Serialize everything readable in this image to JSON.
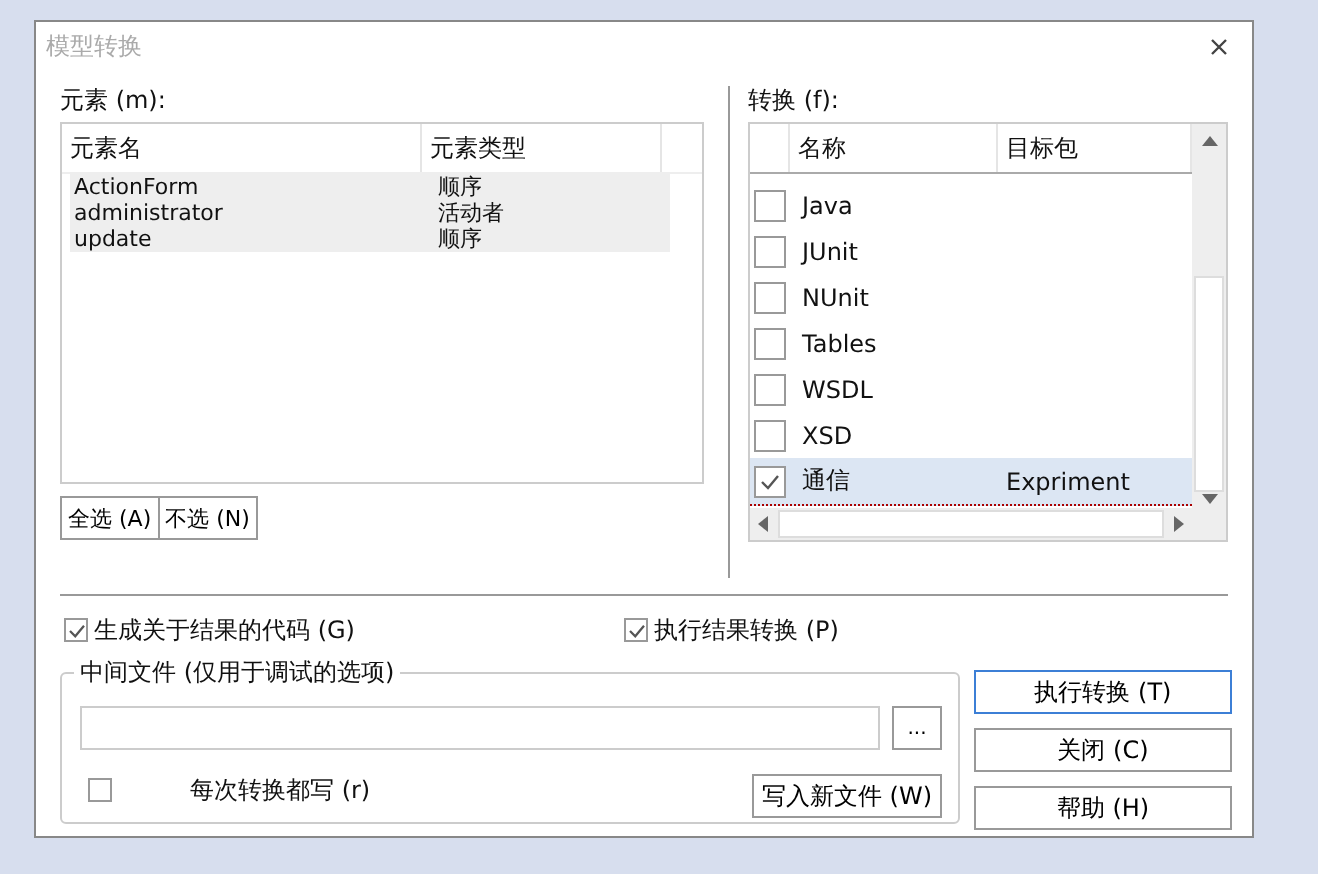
{
  "window": {
    "title": "模型转换"
  },
  "elements": {
    "label": "元素 (m):",
    "columns": [
      "元素名",
      "元素类型"
    ],
    "rows": [
      {
        "name": "ActionForm",
        "type": "顺序",
        "selected": true
      },
      {
        "name": "administrator",
        "type": "活动者",
        "selected": true
      },
      {
        "name": "update",
        "type": "顺序",
        "selected": true
      }
    ],
    "buttons": [
      "全选 (A)",
      "不选 (N)"
    ]
  },
  "transforms": {
    "label": "转换 (f):",
    "columns": [
      "名称",
      "目标包"
    ],
    "rows": [
      {
        "name": "Java",
        "target": "",
        "checked": false,
        "selected": false
      },
      {
        "name": "JUnit",
        "target": "",
        "checked": false,
        "selected": false
      },
      {
        "name": "NUnit",
        "target": "",
        "checked": false,
        "selected": false
      },
      {
        "name": "Tables",
        "target": "",
        "checked": false,
        "selected": false
      },
      {
        "name": "WSDL",
        "target": "",
        "checked": false,
        "selected": false
      },
      {
        "name": "XSD",
        "target": "",
        "checked": false,
        "selected": false
      },
      {
        "name": "通信",
        "target": "Expriment",
        "checked": true,
        "selected": true
      }
    ]
  },
  "options": [
    {
      "label": "生成关于结果的代码 (G)",
      "checked": true
    },
    {
      "label": "执行结果转换 (P)",
      "checked": true
    }
  ],
  "intermediate": {
    "title": "中间文件 (仅用于调试的选项)",
    "browse": "...",
    "always_write": {
      "label": "每次转换都写 (r)",
      "checked": false
    },
    "write_button": "写入新文件 (W)"
  },
  "actions": [
    {
      "label": "执行转换 (T)",
      "default": true
    },
    {
      "label": "关闭 (C)",
      "default": false
    },
    {
      "label": "帮助 (H)",
      "default": false
    }
  ]
}
